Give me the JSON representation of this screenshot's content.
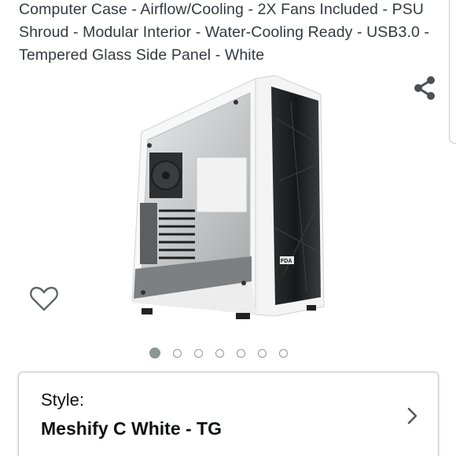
{
  "product": {
    "title": "Computer Case - Airflow/Cooling - 2X Fans Included - PSU Shroud - Modular Interior - Water-Cooling Ready - USB3.0 - Tempered Glass Side Panel - White",
    "image_logo": "FDA"
  },
  "actions": {
    "share_icon": "share-icon",
    "wishlist_icon": "heart-outline-icon"
  },
  "carousel": {
    "total": 7,
    "active_index": 0
  },
  "style_selector": {
    "label": "Style:",
    "value": "Meshify C White - TG",
    "chevron_icon": "chevron-right-icon"
  },
  "colors": {
    "text": "#333a3f",
    "dot": "#8e9595",
    "card_border": "#c9cdcd"
  }
}
